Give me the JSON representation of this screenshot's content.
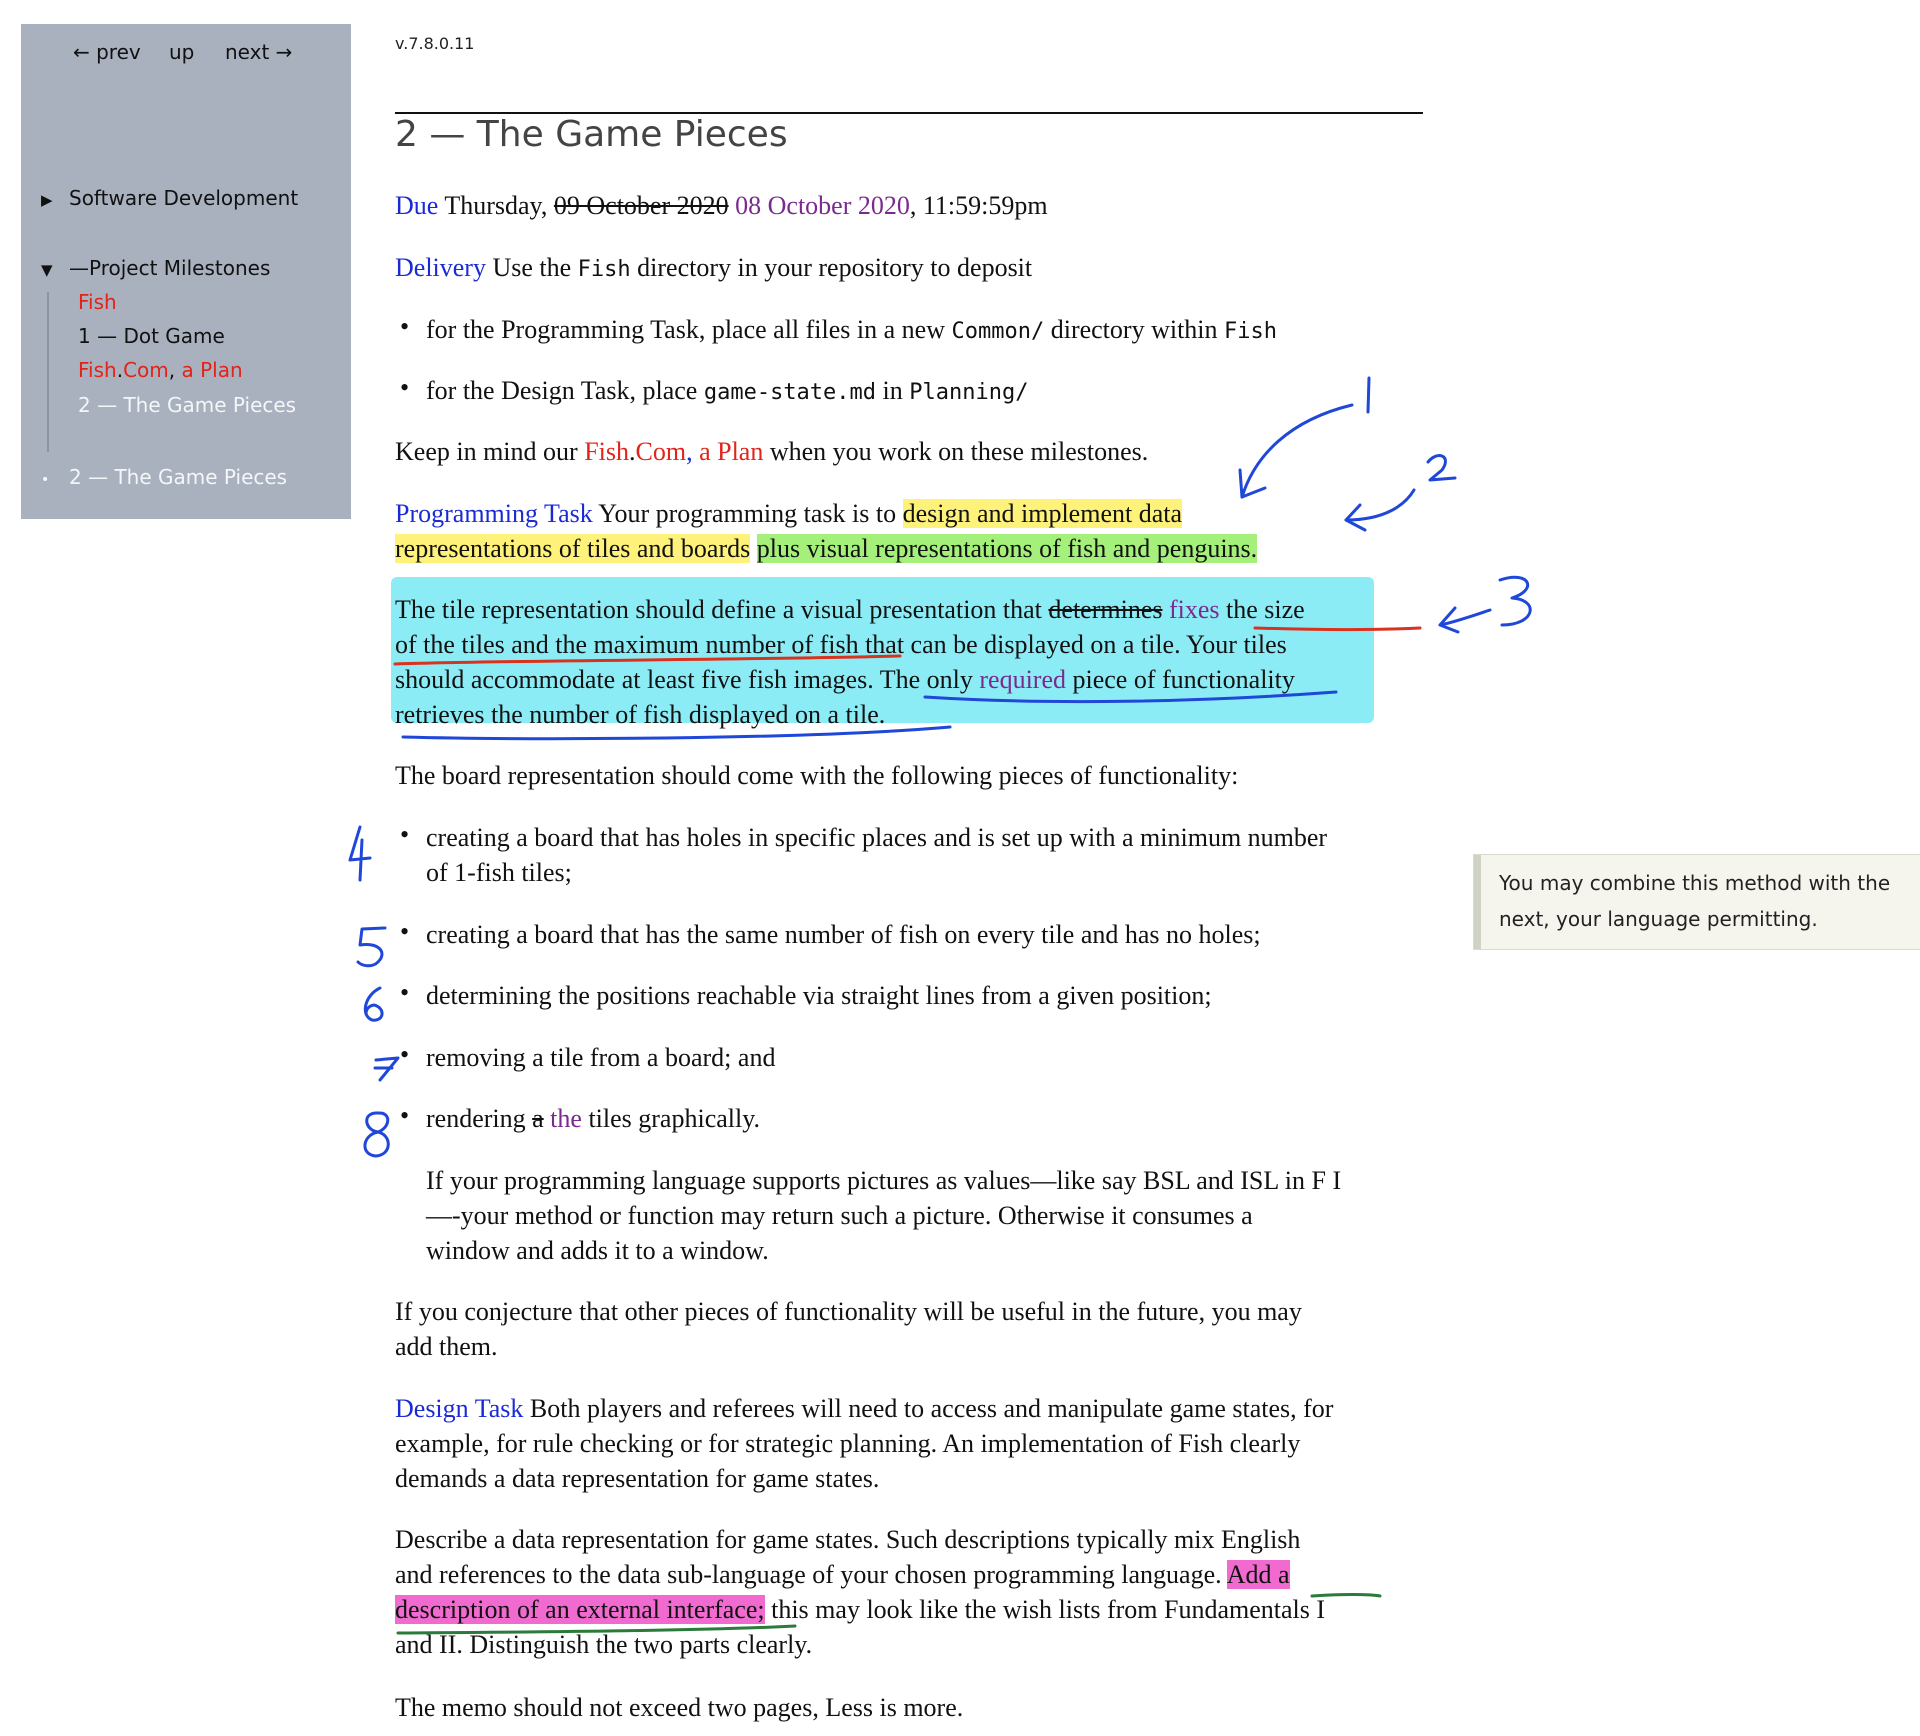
{
  "nav": {
    "prev": "← prev",
    "up": "up",
    "next": "next →"
  },
  "sidebar": {
    "software_development": "Software Development",
    "project_milestones": "—Project Milestones",
    "milestones": {
      "fish": "Fish",
      "dot_game": "1 — Dot Game",
      "fish_com_a": "Fish",
      "fish_com_b": ".",
      "fish_com_c": "Com",
      "fish_com_d": ",",
      "fish_com_e": " a Plan",
      "game_pieces": "2 — The Game Pieces"
    },
    "current_page": "2 — The Game Pieces",
    "tri_collapsed": "▶",
    "tri_expanded": "▼",
    "bullet": "•"
  },
  "page": {
    "version": "v.7.8.0.11",
    "title": "2 — The Game Pieces"
  },
  "due": {
    "label": "Due",
    "day": " Thursday, ",
    "old_date": "09 October 2020",
    "new_date": " 08 October 2020",
    "time": ", 11:59:59pm"
  },
  "delivery": {
    "label": "Delivery",
    "text_a": " Use the ",
    "code": "Fish",
    "text_b": " directory in your repository to deposit"
  },
  "delivery_bullets": [
    {
      "a": "for the Programming Task, place all files in a new ",
      "code1": "Common/",
      "b": " directory within ",
      "code2": "Fish"
    },
    {
      "a": "for the Design Task, place ",
      "code1": "game-state.md",
      "b": " in ",
      "code2": "Planning/"
    }
  ],
  "keep": {
    "a": "Keep in mind our ",
    "link_a": "Fish",
    "link_b": ".",
    "link_c": "Com",
    "link_d": ",",
    "link_e": " a Plan",
    "b": " when you work on these milestones."
  },
  "programming": {
    "label": "Programming Task",
    "a": " Your programming task is to ",
    "hl1": "design and implement data",
    "hl2": "representations of tiles and boards",
    "hl3": "plus visual representations",
    "hl4": " of fish and penguins."
  },
  "tile": {
    "l1a": "The tile representation should define a visual presentation that ",
    "strike": "determines",
    "fixes": " fixes",
    "l1b": " the size",
    "l2": "of the tiles and the maximum number of fish that can be displayed on a tile. Your tiles",
    "l3a": "should accommodate at least five fish images. The only ",
    "required": "required",
    "l3b": " piece of functionality",
    "l4": "retrieves the number of fish displayed on a tile."
  },
  "board_intro": "The board representation should come with the following pieces of functionality:",
  "board_items": [
    {
      "l1": "creating a board that has holes in specific places and is set up with a minimum number",
      "l2": "of 1-fish tiles;"
    },
    {
      "l1": "creating a board that has the same number of fish on every tile and has no holes;"
    },
    {
      "l1": "determining the positions reachable via straight lines from a given position;"
    },
    {
      "l1": "removing a tile from a board; and"
    },
    {
      "a": "rendering ",
      "strike": "a",
      "the": " the",
      "b": " tiles graphically."
    }
  ],
  "bullet_char": "•",
  "pictures": {
    "l1": "If your programming language supports pictures as values—like say BSL and ISL in F I",
    "l2": "—-your method or function may return such a picture. Otherwise it consumes a",
    "l3": "window and adds it to a window."
  },
  "conjecture": {
    "l1": "If you conjecture that other pieces of functionality will be useful in the future, you may",
    "l2": "add them."
  },
  "design": {
    "label": "Design Task",
    "l1": " Both players and referees will need to access and manipulate game states, for",
    "l2": "example, for rule checking or for strategic planning. An implementation of Fish clearly",
    "l3": "demands a data representation for game states."
  },
  "describe": {
    "l1": "Describe a data representation for game states. Such descriptions typically mix English",
    "l2a": "and references to the data sub-language of your chosen programming language. ",
    "hl_a": "Add a",
    "hl_b": "description of an external interface;",
    "l3b": " this may look like the wish lists from Fundamentals I",
    "l4": "and II. Distinguish the two parts clearly."
  },
  "memo": "The memo should not exceed two pages, Less is more.",
  "margin_note": "You may combine this method with the next, your language permitting.",
  "annotations": {
    "numbers": [
      "1",
      "2",
      "3",
      "4",
      "5",
      "6",
      "7",
      "8"
    ],
    "colors": {
      "blue_ink": "#1f47d8",
      "red_ink": "#d9331f",
      "cyan": "#8cecf6",
      "yellow": "#fff27a",
      "green": "#a5f07a",
      "magenta": "#f06ad0"
    }
  }
}
